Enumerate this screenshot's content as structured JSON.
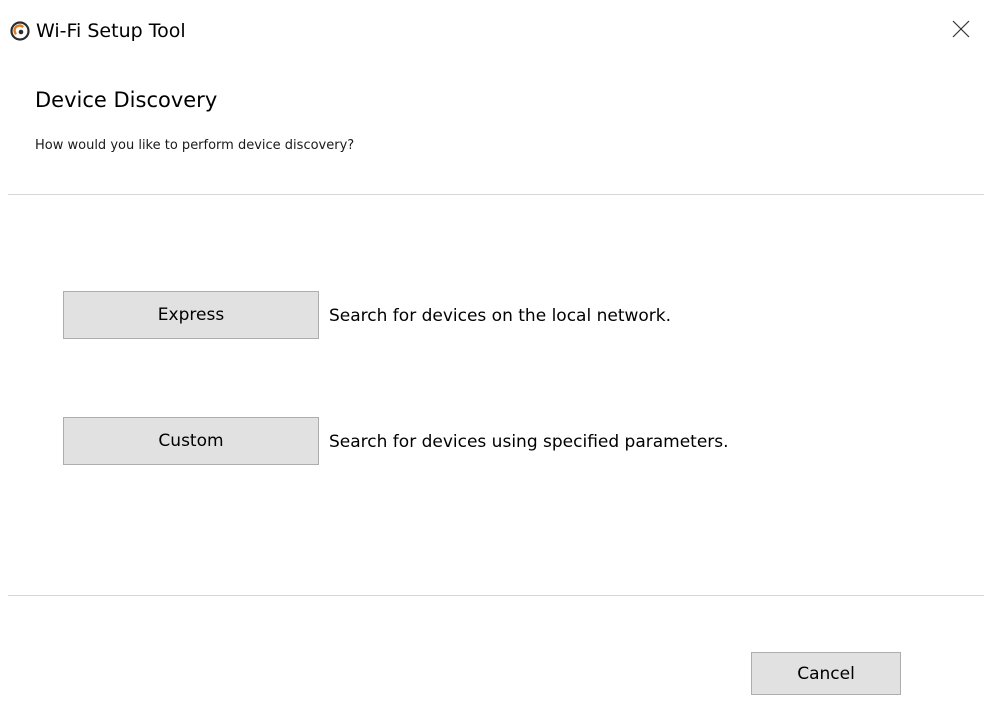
{
  "window": {
    "title": "Wi-Fi Setup Tool",
    "icon": "app-logo-icon",
    "close_icon": "close-icon"
  },
  "page": {
    "heading": "Device Discovery",
    "subheading": "How would you like to perform device discovery?"
  },
  "options": [
    {
      "button_label": "Express",
      "description": "Search for devices on the local network."
    },
    {
      "button_label": "Custom",
      "description": "Search for devices using specified parameters."
    }
  ],
  "footer": {
    "cancel_label": "Cancel"
  },
  "colors": {
    "button_bg": "#e1e1e1",
    "button_border": "#adadad",
    "divider": "#d7d7d7"
  }
}
